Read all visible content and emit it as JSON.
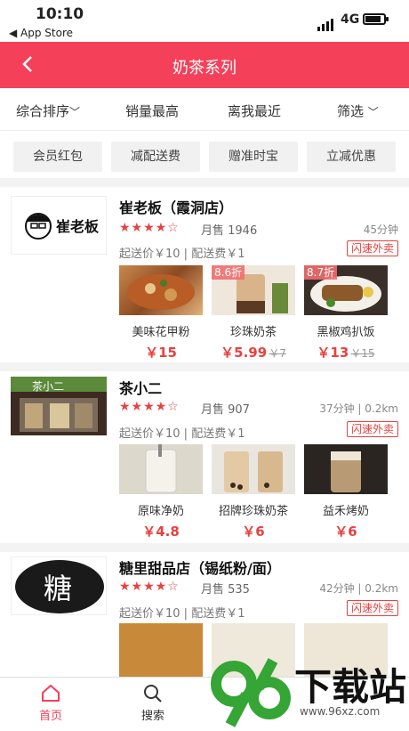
{
  "status": {
    "time": "10:10",
    "back_label": "◀ App Store",
    "network": "4G"
  },
  "header": {
    "title": "奶茶系列"
  },
  "sort": {
    "items": [
      "综合排序",
      "销量最高",
      "离我最近",
      "筛选"
    ]
  },
  "chips": [
    "会员红包",
    "减配送费",
    "赠准时宝",
    "立减优惠"
  ],
  "shops": [
    {
      "name": "崔老板（霞洞店）",
      "logo_text": "崔老板",
      "rating": 4,
      "sales": "月售 1946",
      "distance": "45分钟",
      "min_price": "起送价￥10",
      "delivery_fee": "配送费￥1",
      "badge": "闪速外卖",
      "dishes": [
        {
          "name": "美味花甲粉",
          "price": "￥15",
          "old_price": "",
          "discount": ""
        },
        {
          "name": "珍珠奶茶",
          "price": "￥5.99",
          "old_price": "￥7",
          "discount": "8.6折"
        },
        {
          "name": "黑椒鸡扒饭",
          "price": "￥13",
          "old_price": "￥15",
          "discount": "8.7折"
        }
      ]
    },
    {
      "name": "茶小二",
      "logo_text": "茶小二",
      "rating": 4,
      "sales": "月售 907",
      "distance": "37分钟 | 0.2km",
      "min_price": "起送价￥10",
      "delivery_fee": "配送费￥1",
      "badge": "闪速外卖",
      "dishes": [
        {
          "name": "原味净奶",
          "price": "￥4.8",
          "old_price": "",
          "discount": ""
        },
        {
          "name": "招牌珍珠奶茶",
          "price": "￥6",
          "old_price": "",
          "discount": ""
        },
        {
          "name": "益禾烤奶",
          "price": "￥6",
          "old_price": "",
          "discount": ""
        }
      ]
    },
    {
      "name": "糖里甜品店（锡纸粉/面）",
      "logo_text": "糖",
      "rating": 4,
      "sales": "月售 535",
      "distance": "42分钟 | 0.2km",
      "min_price": "起送价￥10",
      "delivery_fee": "配送费￥1",
      "badge": "闪速外卖",
      "dishes": []
    }
  ],
  "tabs": {
    "home": "首页",
    "search": "搜索"
  },
  "watermark": {
    "text": "下载站",
    "url": "www.96xz.com"
  },
  "colors": {
    "accent": "#f5405a",
    "price": "#e8413f"
  }
}
